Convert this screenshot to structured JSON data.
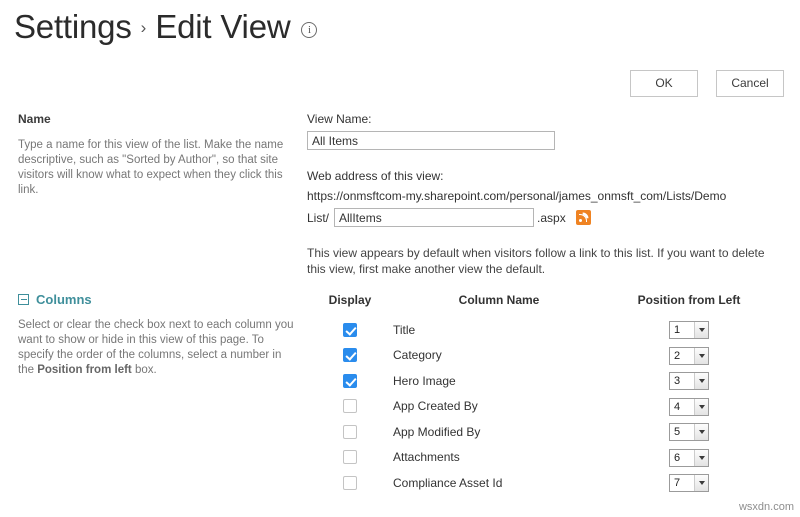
{
  "header": {
    "breadcrumb_root": "Settings",
    "separator": "›",
    "page_title": "Edit View",
    "info_glyph": "i"
  },
  "toolbar": {
    "ok_label": "OK",
    "cancel_label": "Cancel"
  },
  "name_section": {
    "title": "Name",
    "description": "Type a name for this view of the list. Make the name descriptive, such as \"Sorted by Author\", so that site visitors will know what to expect when they click this link.",
    "view_name_label": "View Name:",
    "view_name_value": "All Items",
    "web_address_label": "Web address of this view:",
    "url_base": "https://onmsftcom-my.sharepoint.com/personal/james_onmsft_com/Lists/Demo",
    "url_prefix": "List/",
    "url_value": "AllItems",
    "url_suffix": ".aspx",
    "rss_icon": "rss-icon",
    "default_note": "This view appears by default when visitors follow a link to this list. If you want to delete this view, first make another view the default."
  },
  "columns_section": {
    "collapse_icon": "collapse-minus-icon",
    "title": "Columns",
    "description_part1": "Select or clear the check box next to each column you want to show or hide in this view of this page. To specify the order of the columns, select a number in the ",
    "description_bold": "Position from left",
    "description_part2": " box.",
    "headers": {
      "display": "Display",
      "column_name": "Column Name",
      "position": "Position from Left"
    },
    "rows": [
      {
        "name": "Title",
        "checked": true,
        "position": "1"
      },
      {
        "name": "Category",
        "checked": true,
        "position": "2"
      },
      {
        "name": "Hero Image",
        "checked": true,
        "position": "3"
      },
      {
        "name": "App Created By",
        "checked": false,
        "position": "4"
      },
      {
        "name": "App Modified By",
        "checked": false,
        "position": "5"
      },
      {
        "name": "Attachments",
        "checked": false,
        "position": "6"
      },
      {
        "name": "Compliance Asset Id",
        "checked": false,
        "position": "7"
      }
    ]
  },
  "watermark": "wsxdn.com",
  "colors": {
    "accent_checkbox": "#2a8ced",
    "section_heading": "#3f8f9b",
    "rss_orange": "#ef8322"
  }
}
